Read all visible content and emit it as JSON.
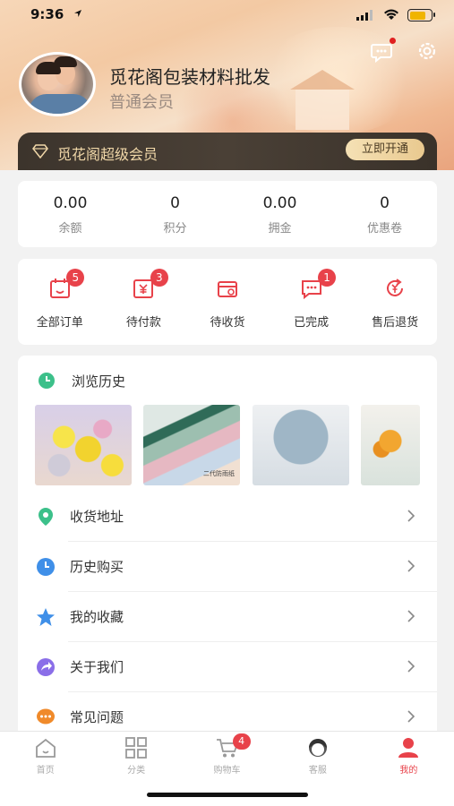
{
  "status_bar": {
    "time": "9:36"
  },
  "profile": {
    "shop_name": "觅花阁包装材料批发",
    "member_level": "普通会员"
  },
  "vip": {
    "label": "觅花阁超级会员",
    "button": "立即开通"
  },
  "stats": [
    {
      "value": "0.00",
      "label": "余额"
    },
    {
      "value": "0",
      "label": "积分"
    },
    {
      "value": "0.00",
      "label": "拥金"
    },
    {
      "value": "0",
      "label": "优惠卷"
    }
  ],
  "orders": [
    {
      "label": "全部订单",
      "badge": "5",
      "icon": "calendar-face-icon"
    },
    {
      "label": "待付款",
      "badge": "3",
      "icon": "wallet-yen-icon"
    },
    {
      "label": "待收货",
      "badge": "",
      "icon": "package-icon"
    },
    {
      "label": "已完成",
      "badge": "1",
      "icon": "chat-bubble-icon"
    },
    {
      "label": "售后退货",
      "badge": "",
      "icon": "yen-refund-icon"
    }
  ],
  "history": {
    "title": "浏览历史",
    "thumb_caption": "二代防雨纸"
  },
  "menu": [
    {
      "label": "收货地址",
      "icon": "location-pin-icon",
      "color": "#3cc08a"
    },
    {
      "label": "历史购买",
      "icon": "clock-icon",
      "color": "#3f8fe8"
    },
    {
      "label": "我的收藏",
      "icon": "star-icon",
      "color": "#3f8fe8"
    },
    {
      "label": "关于我们",
      "icon": "share-arrow-icon",
      "color": "#8a6ee8"
    },
    {
      "label": "常见问题",
      "icon": "chat-dots-icon",
      "color": "#f08a2a"
    }
  ],
  "tabbar": {
    "items": [
      {
        "label": "首页",
        "icon": "home-icon"
      },
      {
        "label": "分类",
        "icon": "grid-icon"
      },
      {
        "label": "购物车",
        "icon": "cart-icon"
      },
      {
        "label": "客服",
        "icon": "service-agent-icon"
      },
      {
        "label": "我的",
        "icon": "user-icon"
      }
    ],
    "cart_badge": "4",
    "active": "我的"
  },
  "colors": {
    "accent": "#e8424a",
    "vip_gold": "#f0d7a8",
    "vip_dark": "#3c342c"
  }
}
